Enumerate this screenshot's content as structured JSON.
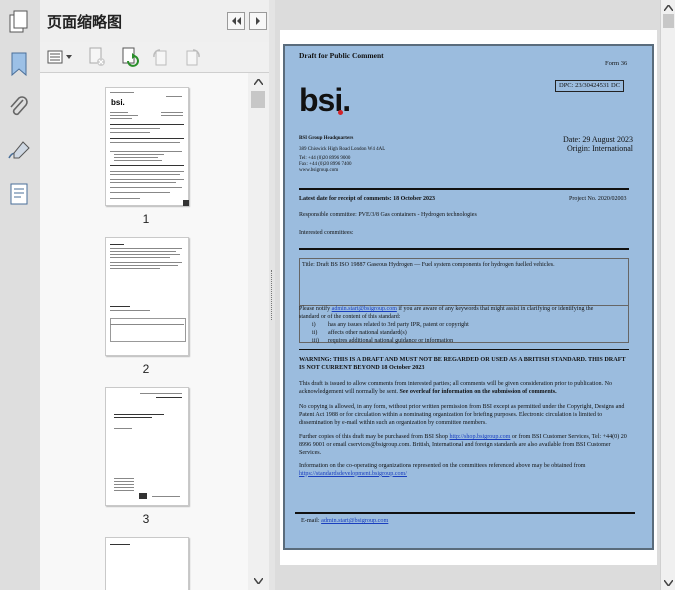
{
  "panel": {
    "title": "页面缩略图"
  },
  "thumbnails": [
    {
      "page": "1"
    },
    {
      "page": "2"
    },
    {
      "page": "3"
    }
  ],
  "document": {
    "draft_label": "Draft for Public Comment",
    "form": "Form 36",
    "dpc": "DPC: 23/30424531 DC",
    "logo": "bsi.",
    "hq_title": "BSI Group Headquarters",
    "hq_address": "389 Chiswick High Road London W4 4AL",
    "hq_tel": "Tel: +44 (0)20 8996 9000",
    "hq_fax": "Fax: +44 (0)20 8996 7400",
    "hq_web": "www.bsigroup.com",
    "date": "Date: 29 August 2023",
    "origin": "Origin: International",
    "latest_date": "Latest date for receipt of comments: 18 October 2023",
    "project_no": "Project No. 2020/02003",
    "committee": "Responsible committee: PVE/3/8 Gas containers - Hydrogen technologies",
    "interested": "Interested committees:",
    "title_line": "Title: Draft BS ISO 19887 Gaseous Hydrogen — Fuel system components for hydrogen fuelled vehicles.",
    "notify_prefix": "Please notify ",
    "notify_email": "admin.start@bsigroup.com",
    "notify_rest": " if you are aware of any keywords that might assist in clarifying or identifying the",
    "notify_line2": "standard or of the content of this standard:",
    "notify_items": [
      {
        "num": "i)",
        "text": "has any issues related to 3rd party IPR, patent or copyright"
      },
      {
        "num": "ii)",
        "text": "affects other national standard(s)"
      },
      {
        "num": "iii)",
        "text": "requires additional national guidance or information"
      }
    ],
    "warning": "WARNING: THIS IS A DRAFT AND MUST NOT BE REGARDED OR USED AS A BRITISH STANDARD. THIS DRAFT IS NOT CURRENT BEYOND 18 October 2023",
    "para1_a": "This draft is issued to allow comments from interested parties; all comments will be given consideration prior to publication. No acknowledgement will normally be sent. ",
    "para1_b": "See overleaf for information on the submission of comments.",
    "para2": "No copying is allowed, in any form, without prior written permission from BSI except as permitted under the Copyright, Designs and Patent Act 1988 or for circulation within a nominating organization for briefing purposes. Electronic circulation is limited to dissemination by e-mail within such an organization by committee members.",
    "para3_a": "Further copies of this draft may be purchased from BSI Shop ",
    "para3_link": "http://shop.bsigroup.com",
    "para3_b": " or from BSI Customer Services, Tel: +44(0) 20 8996 9001 or email cservices@bsigroup.com. British, International and foreign standards are also available from BSI Customer Services.",
    "para4_a": "Information on the co-operating organizations represented on the committees referenced above may be obtained from ",
    "para4_link": "https://standardsdevelopment.bsigroup.com/",
    "email_label": "E-mail: ",
    "email_value": "admin.start@bsigroup.com"
  },
  "colors": {
    "page_bg": "#9bbcde",
    "logo_red": "#d2232a",
    "link": "#1a3fbf"
  }
}
